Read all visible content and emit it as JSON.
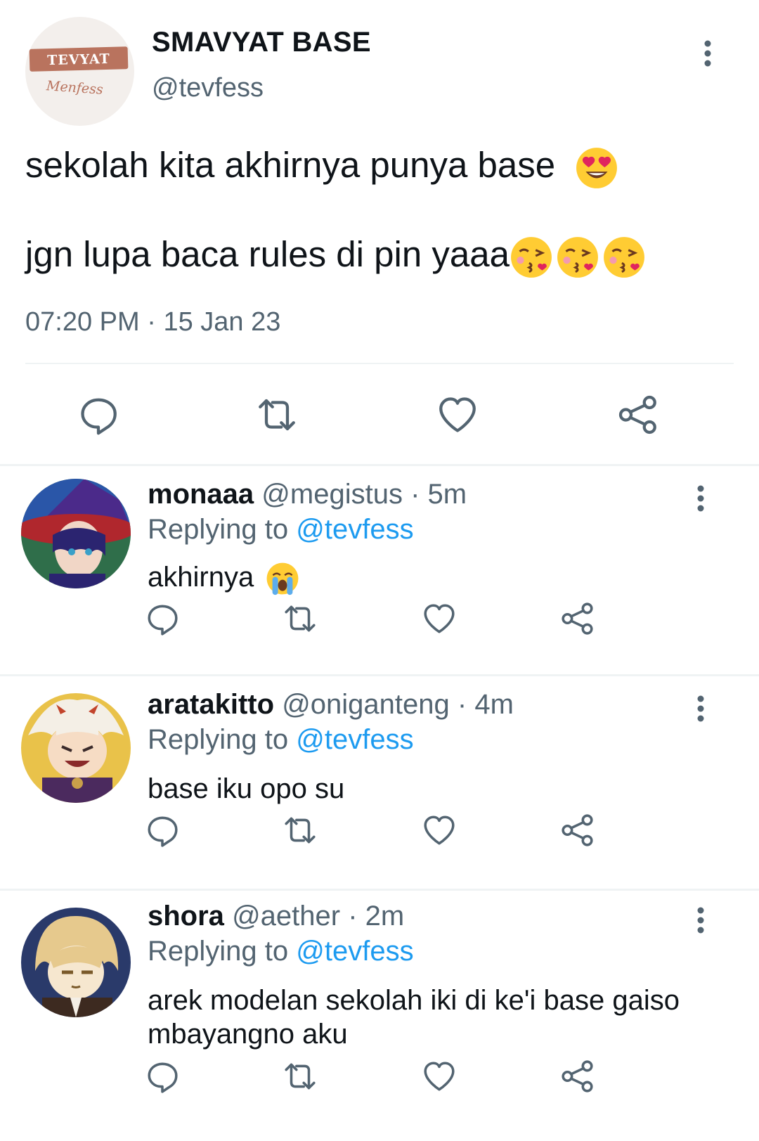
{
  "main_tweet": {
    "avatar": {
      "banner_text": "TEVYAT",
      "script_text": "Menfess"
    },
    "display_name": "SMAVYAT BASE",
    "handle": "@tevfess",
    "text_line1": "sekolah kita akhirnya punya base",
    "text_line2": "jgn lupa baca rules di pin yaaa",
    "emoji_line1": "smiling-face-with-heart-eyes",
    "emoji_line2": [
      "face-blowing-a-kiss",
      "face-blowing-a-kiss",
      "face-blowing-a-kiss"
    ],
    "timestamp": "07:20 PM",
    "separator": "·",
    "date": "15 Jan 23",
    "actions": [
      "reply",
      "retweet",
      "like",
      "share"
    ]
  },
  "replies": [
    {
      "display_name": "monaaa",
      "handle": "@megistus",
      "separator": "·",
      "time": "5m",
      "replying_prefix": "Replying to",
      "replying_to": "@tevfess",
      "text": "akhirnya",
      "emoji": "loudly-crying-face",
      "avatar_colors": [
        "#2b2470",
        "#6a3a9a",
        "#b0272d",
        "#2f6e4a"
      ]
    },
    {
      "display_name": "aratakitto",
      "handle": "@oniganteng",
      "separator": "·",
      "time": "4m",
      "replying_prefix": "Replying to",
      "replying_to": "@tevfess",
      "text": "base iku opo su",
      "avatar_colors": [
        "#e9c24a",
        "#f4efe6",
        "#4b2a5e",
        "#c2442c"
      ]
    },
    {
      "display_name": "shora",
      "handle": "@aether",
      "separator": "·",
      "time": "2m",
      "replying_prefix": "Replying to",
      "replying_to": "@tevfess",
      "text": "arek modelan sekolah iki di ke'i base gaiso mbayangno aku",
      "avatar_colors": [
        "#2a3a6a",
        "#e6c98d",
        "#f6e7cf",
        "#3d2a20"
      ]
    }
  ],
  "colors": {
    "text_primary": "#0f1419",
    "text_secondary": "#536471",
    "link": "#1d9bf0",
    "divider": "#eff3f4"
  }
}
